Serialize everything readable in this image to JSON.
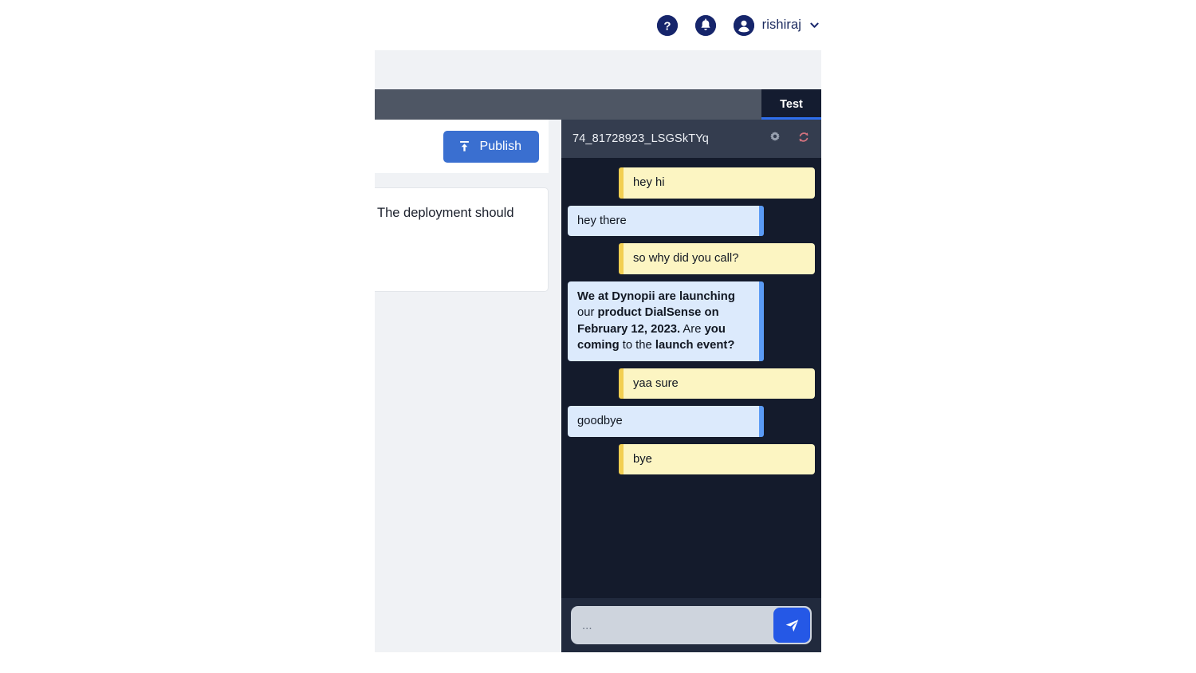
{
  "header": {
    "help_icon": "question-mark-icon",
    "notification_icon": "bell-icon",
    "avatar_icon": "user-avatar-icon",
    "user_name": "rishiraj",
    "caret_icon": "chevron-down-icon",
    "icon_color": "#16256b"
  },
  "tabs": [
    {
      "label": "Test",
      "active": true
    }
  ],
  "editor": {
    "publish_label": "Publish",
    "publish_icon": "upload-icon",
    "publish_color": "#3a6fd0",
    "note_text": "The deployment should"
  },
  "chat": {
    "session_id": "74_81728923_LSGSkTYq",
    "settings_icon": "gear-icon",
    "reset_icon": "refresh-icon",
    "reset_icon_color": "#d4737f",
    "panel_bg": "#141b2c",
    "header_bg": "#343d4f",
    "bot_bubble_color": "#fcf5c2",
    "bot_accent_color": "#f2cf51",
    "user_bubble_color": "#dceafc",
    "user_accent_color": "#5b9bf5",
    "messages": [
      {
        "side": "right",
        "role": "bot",
        "html": "hey hi"
      },
      {
        "side": "left",
        "role": "user",
        "html": "hey there"
      },
      {
        "side": "right",
        "role": "bot",
        "html": "so why did you call?"
      },
      {
        "side": "left",
        "role": "user",
        "html": "<b>We at Dynopii are launching</b> our <b>product DialSense on February 12, 2023.</b> Are <b>you coming</b> to the <b>launch event?</b>"
      },
      {
        "side": "right",
        "role": "bot",
        "html": "yaa sure"
      },
      {
        "side": "left",
        "role": "user",
        "html": "goodbye"
      },
      {
        "side": "right",
        "role": "bot",
        "html": "bye"
      }
    ],
    "input_value": "",
    "input_placeholder": "...",
    "send_icon": "send-paper-plane-icon",
    "send_button_color": "#2558e6"
  }
}
